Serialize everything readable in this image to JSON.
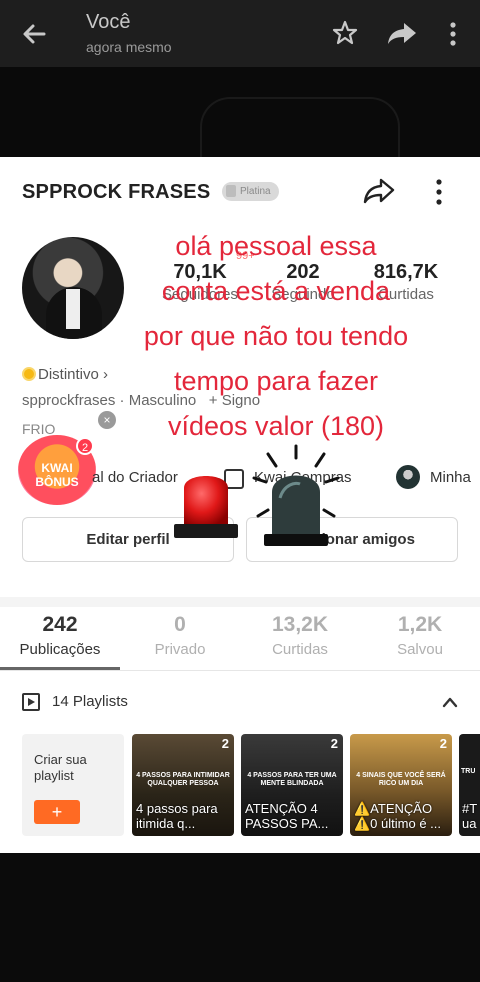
{
  "topbar": {
    "title": "Você",
    "subtitle": "agora mesmo"
  },
  "profile": {
    "name": "SPPROCK FRASES",
    "plan_badge": "Platina",
    "stats": [
      {
        "value": "70,1K",
        "label": "Seguidores"
      },
      {
        "value": "202",
        "label": "Seguindo"
      },
      {
        "value": "816,7K",
        "label": "Curtidas"
      }
    ],
    "notif_badge": "99+",
    "distintivo": "Distintivo",
    "handle": "spprockfrases",
    "gender": "Masculino",
    "sign": "+ Signo",
    "bio": "FRIO",
    "links": {
      "creator": "al do Criador",
      "shop": "Kwai Compras",
      "mine": "Minha"
    },
    "kwai_bonus": {
      "line1": "KWAI",
      "line2": "BÔNUS",
      "count": "2"
    },
    "buttons": {
      "edit": "Editar perfil",
      "add": "Adicionar amigos"
    }
  },
  "tabs": [
    {
      "value": "242",
      "label": "Publicações"
    },
    {
      "value": "0",
      "label": "Privado"
    },
    {
      "value": "13,2K",
      "label": "Curtidas"
    },
    {
      "value": "1,2K",
      "label": "Salvou"
    }
  ],
  "playlists": {
    "title": "14 Playlists",
    "create_label": "Criar sua playlist",
    "create_button": "+",
    "items": [
      {
        "count": "2",
        "small": "4 PASSOS PARA INTIMIDAR QUALQUER PESSOA",
        "big": "4 passos para itimida q..."
      },
      {
        "count": "2",
        "small": "4 PASSOS PARA TER UMA MENTE BLINDADA",
        "big": "ATENÇÃO 4 PASSOS PA..."
      },
      {
        "count": "2",
        "small": "4 SINAIS QUE VOCÊ SERÁ RICO UM DIA",
        "big": "⚠️ATENÇÃO ⚠️0 último é ..."
      },
      {
        "count": "",
        "small": "TRU",
        "big": "#T ua"
      }
    ]
  },
  "overlay": {
    "lines": [
      "olá pessoal  essa",
      "conta está a  venda",
      "por que não tou tendo",
      "tempo para fazer",
      "vídeos valor (180)"
    ]
  },
  "colors": {
    "overlay_text": "#e3273b",
    "accent_orange": "#ff6a23",
    "siren_red": "#e01818"
  }
}
